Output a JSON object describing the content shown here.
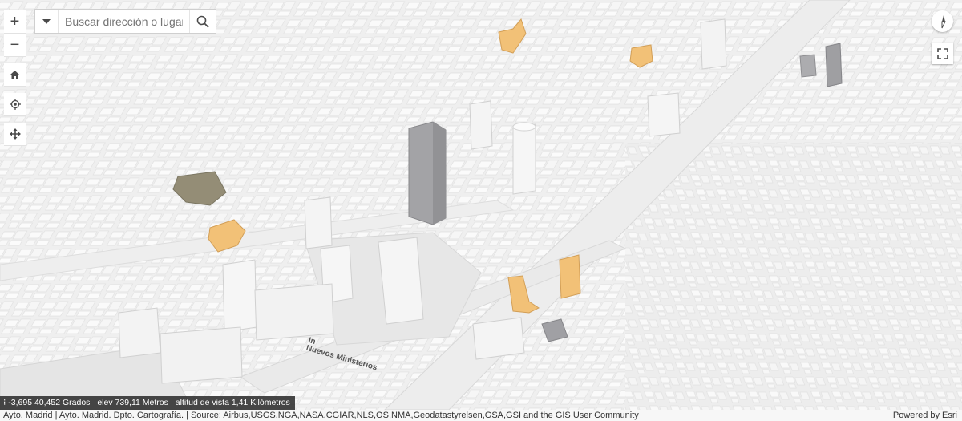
{
  "search": {
    "placeholder": "Buscar dirección o lugar"
  },
  "nav": {
    "zoom_in_symbol": "+",
    "zoom_out_symbol": "−"
  },
  "map": {
    "label_fragment": "In",
    "label_place": "Nuevos Ministerios",
    "highlight_color": "#f0b45a",
    "gray_building_color": "#8f8f93",
    "olive_building_color": "#7d7558"
  },
  "coordinates": {
    "position": "-3,695 40,452 Grados",
    "elevation": "elev 739,11 Metros",
    "altitude": "altitud de vista 1,41 Kilómetros"
  },
  "attribution": {
    "sources": "Ayto. Madrid | Ayto. Madrid. Dpto. Cartografía. | Source: Airbus,USGS,NGA,NASA,CGIAR,NLS,OS,NMA,Geodatastyrelsen,GSA,GSI and the GIS User Community",
    "powered_by": "Powered by Esri"
  }
}
